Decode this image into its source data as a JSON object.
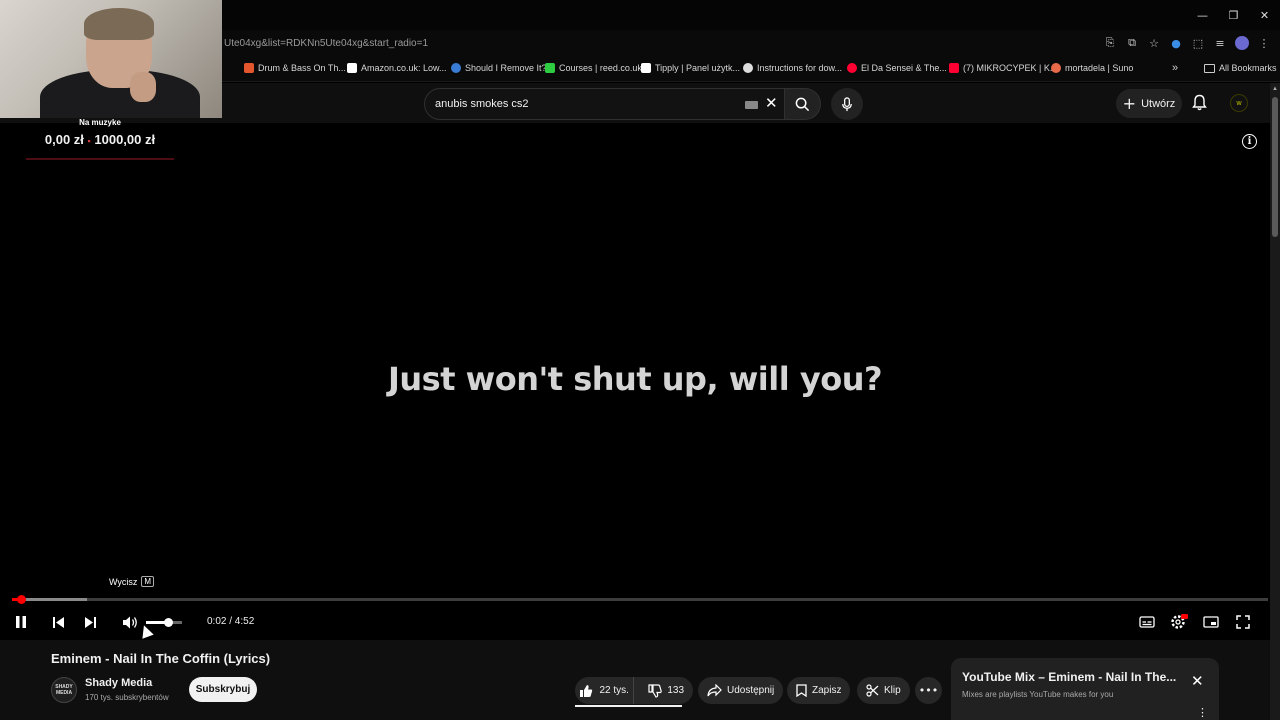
{
  "browser": {
    "url": "Ute04xg&list=RDKNn5Ute04xg&start_radio=1",
    "bookmarks": [
      {
        "label": "Drum & Bass On Th...",
        "color": "#e4572e"
      },
      {
        "label": "Amazon.co.uk: Low...",
        "color": "#ffffff"
      },
      {
        "label": "Should I Remove It?",
        "color": "#3a7bd5"
      },
      {
        "label": "Courses | reed.co.uk",
        "color": "#2ecc40"
      },
      {
        "label": "Tipply | Panel użytk...",
        "color": "#ffffff"
      },
      {
        "label": "Instructions for dow...",
        "color": "#dddddd"
      },
      {
        "label": "El Da Sensei & The...",
        "color": "#ff0033"
      },
      {
        "label": "(7) MIKROCYPEK | K...",
        "color": "#ff0033"
      },
      {
        "label": "mortadela | Suno",
        "color": "#e86a4a"
      }
    ],
    "all_bookmarks": "All Bookmarks"
  },
  "header": {
    "search_query": "anubis smokes cs2",
    "create_label": "Utwórz",
    "avatar_letter": "w"
  },
  "overlay": {
    "donation_label": "Na muzyke",
    "donation_current": "0,00 zł",
    "donation_goal": "1000,00 zł",
    "donation_progress": 0
  },
  "player": {
    "lyric": "Just won't shut up, will you?",
    "tooltip_label": "Wycisz",
    "tooltip_key": "M",
    "time": "0:02 / 4:52",
    "played_fraction": 0.0069,
    "loaded_fraction": 0.06,
    "volume_fraction": 0.6
  },
  "video": {
    "title": "Eminem - Nail In The Coffin (Lyrics)",
    "channel_name": "Shady Media",
    "channel_avatar_text": "SHADY MEDIA",
    "subscribers": "170 tys. subskrybentów",
    "subscribe_label": "Subskrybuj",
    "likes": "22 tys.",
    "dislikes": "133",
    "share_label": "Udostępnij",
    "save_label": "Zapisz",
    "clip_label": "Klip"
  },
  "mix": {
    "title": "YouTube Mix – Eminem - Nail In The...",
    "subtitle": "Mixes are playlists YouTube makes for you"
  },
  "colors": {
    "accent": "#ff0000",
    "background": "#0f0f0f",
    "pill": "#272727"
  }
}
